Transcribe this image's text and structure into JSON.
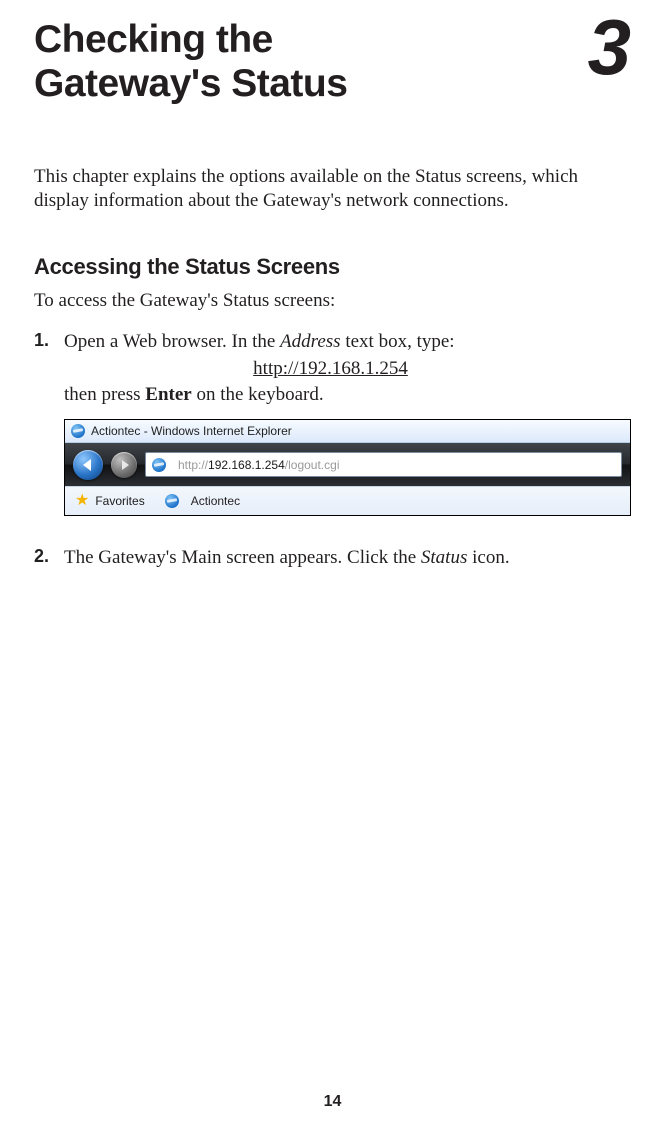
{
  "chapter": {
    "title_line1": "Checking the",
    "title_line2": "Gateway's Status",
    "number": "3"
  },
  "intro": "This chapter explains the options available on the Status screens, which display information about the Gateway's network connections.",
  "section_heading": "Accessing the Status Screens",
  "lead": "To access the Gateway's Status screens:",
  "steps": {
    "s1": {
      "num": "1.",
      "part1": "Open a Web browser. In the ",
      "italic": "Address",
      "part2": " text box, type:",
      "url": "http://192.168.1.254",
      "part3a": "then press ",
      "bold": "Enter",
      "part3b": " on the keyboard."
    },
    "s2": {
      "num": "2.",
      "part1": "The Gateway's Main screen appears. Click the ",
      "italic": "Status",
      "part2": " icon."
    }
  },
  "browser": {
    "window_title": "Actiontec - Windows Internet Explorer",
    "addr_prefix": "http://",
    "addr_host": "192.168.1.254",
    "addr_suffix": "/logout.cgi",
    "favorites_label": "Favorites",
    "tab_label": "Actiontec"
  },
  "page_number": "14"
}
